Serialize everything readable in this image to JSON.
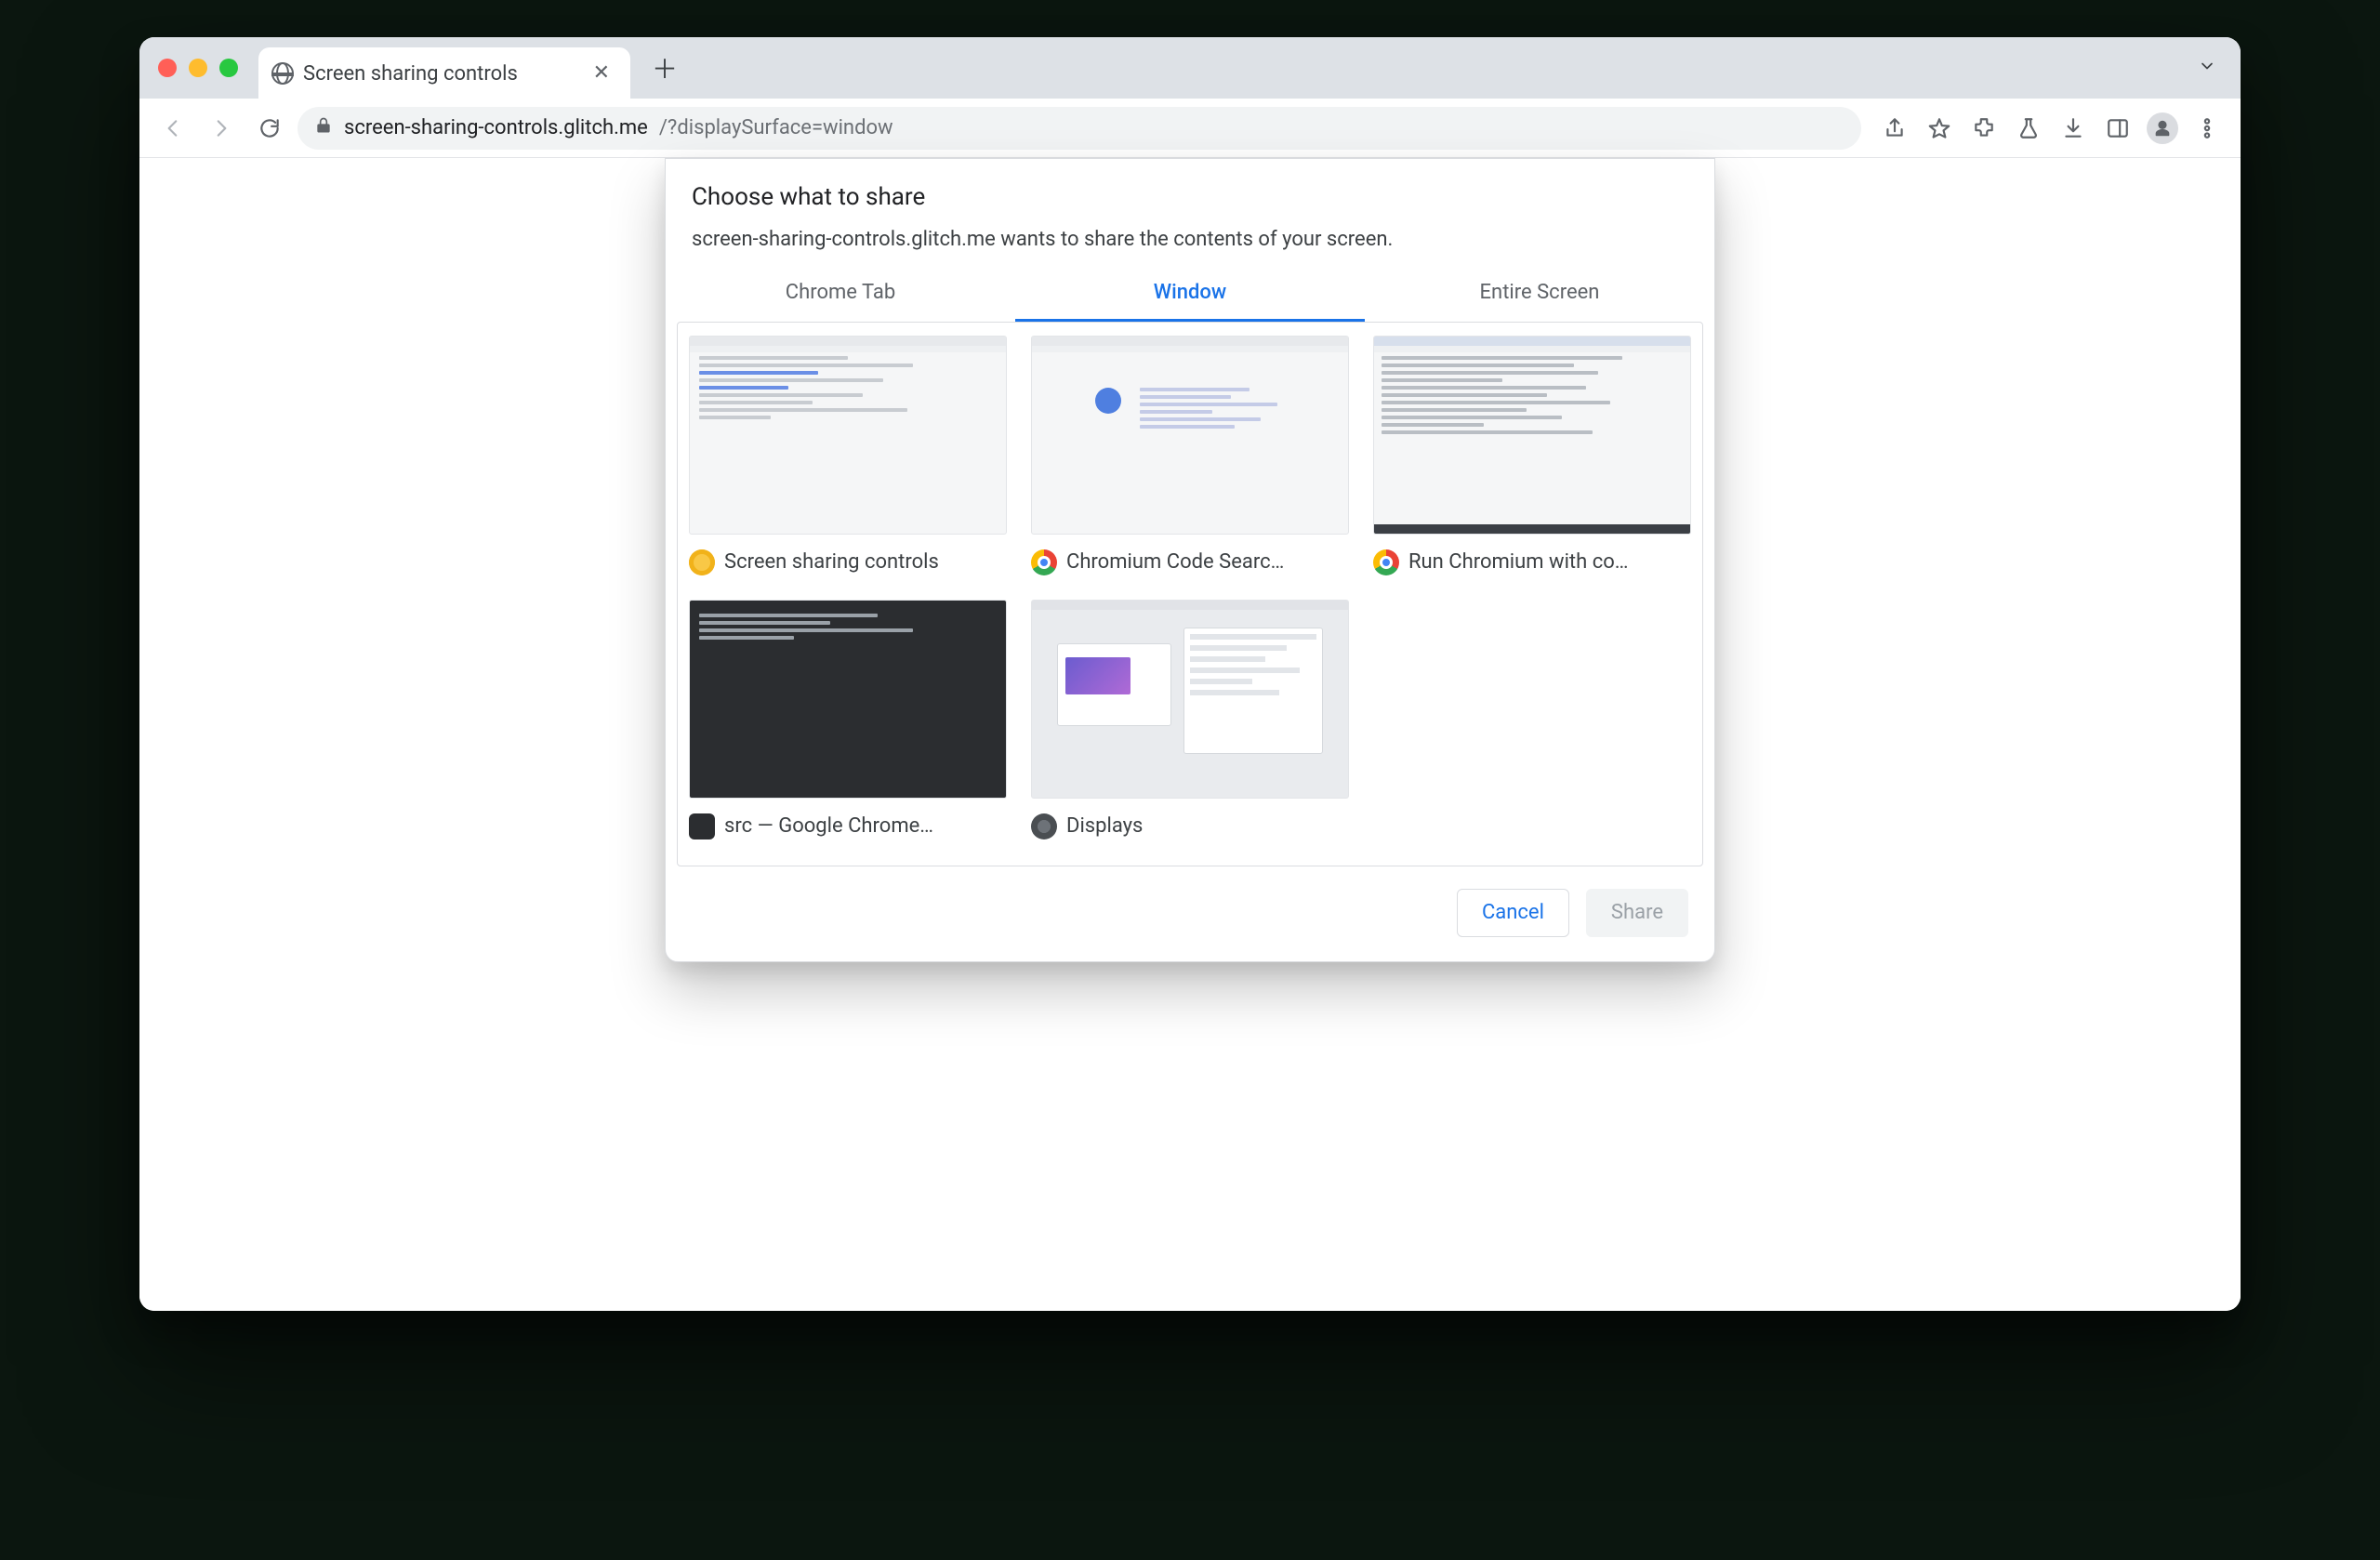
{
  "tab": {
    "title": "Screen sharing controls"
  },
  "url": {
    "host": "screen-sharing-controls.glitch.me",
    "path": "/?displaySurface=window"
  },
  "dialog": {
    "title": "Choose what to share",
    "subtitle": "screen-sharing-controls.glitch.me wants to share the contents of your screen.",
    "tabs": {
      "chrome_tab": "Chrome Tab",
      "window": "Window",
      "entire_screen": "Entire Screen"
    },
    "windows": [
      {
        "label": "Screen sharing controls",
        "icon": "canary"
      },
      {
        "label": "Chromium Code Searc…",
        "icon": "chrome"
      },
      {
        "label": "Run Chromium with co…",
        "icon": "chrome"
      },
      {
        "label": "src — Google Chrome…",
        "icon": "term"
      },
      {
        "label": "Displays",
        "icon": "sys"
      }
    ],
    "buttons": {
      "cancel": "Cancel",
      "share": "Share"
    }
  }
}
